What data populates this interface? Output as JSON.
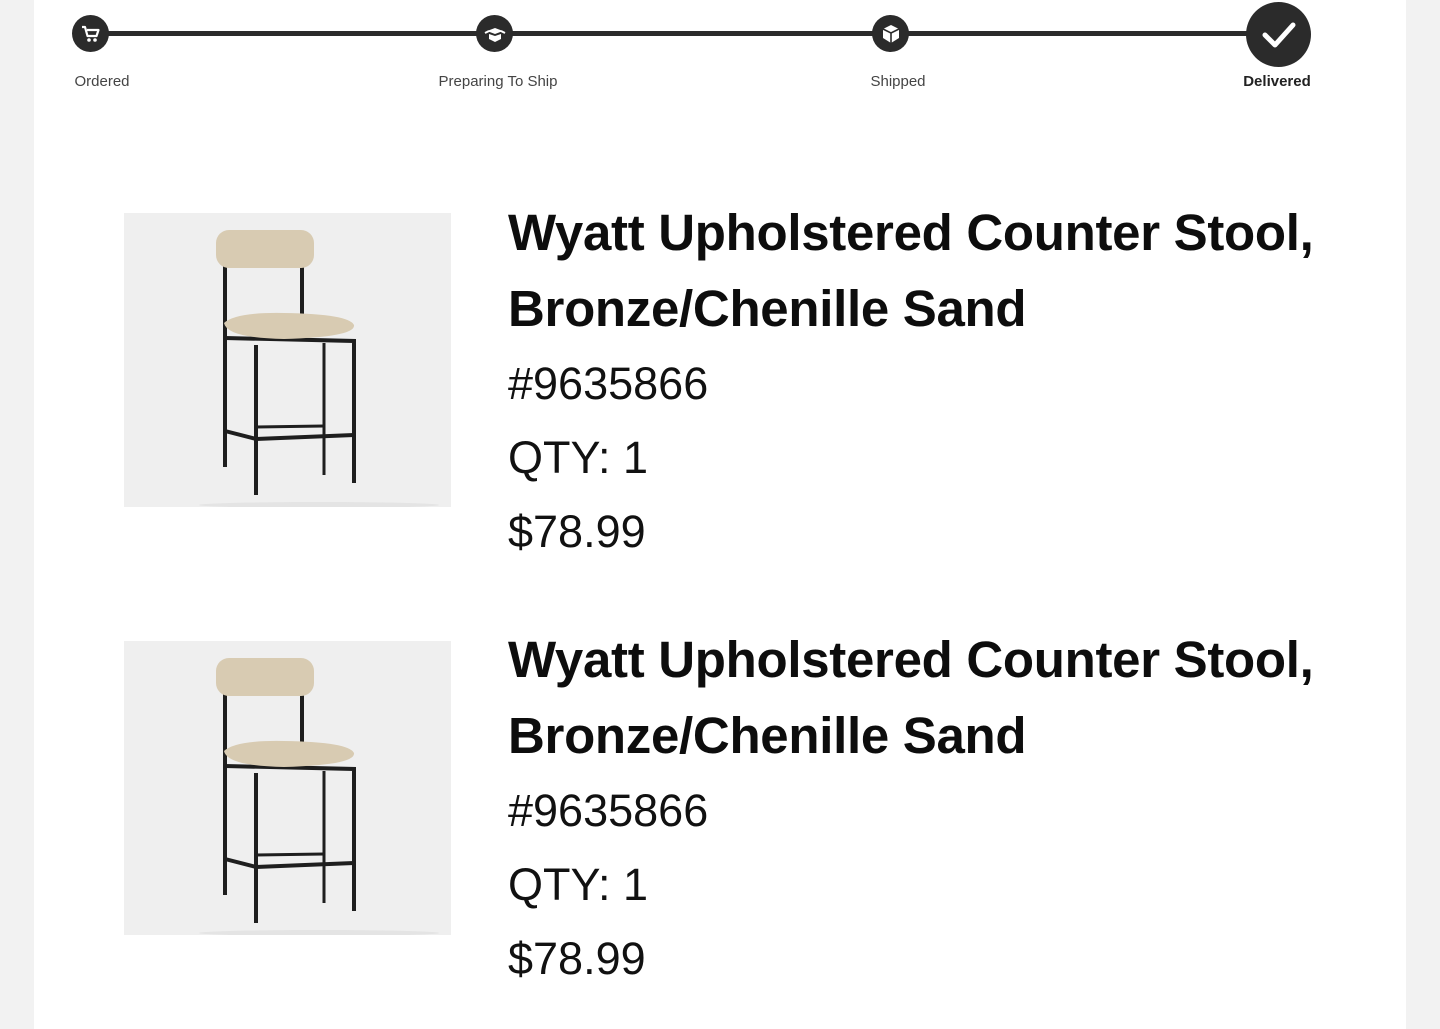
{
  "tracker": {
    "steps": [
      {
        "label": "Ordered",
        "icon": "cart-icon"
      },
      {
        "label": "Preparing To Ship",
        "icon": "box-open-icon"
      },
      {
        "label": "Shipped",
        "icon": "package-icon"
      },
      {
        "label": "Delivered",
        "icon": "checkmark-icon"
      }
    ],
    "current": "Delivered"
  },
  "items": [
    {
      "title_line1": "Wyatt Upholstered Counter Stool,",
      "title_line2": "Bronze/Chenille Sand",
      "sku": "#9635866",
      "qty": "QTY: 1",
      "price": "$78.99",
      "image": "counter-stool-image"
    },
    {
      "title_line1": "Wyatt Upholstered Counter Stool,",
      "title_line2": "Bronze/Chenille Sand",
      "sku": "#9635866",
      "qty": "QTY: 1",
      "price": "$78.99",
      "image": "counter-stool-image"
    }
  ],
  "colors": {
    "background": "#f2f2f2",
    "card": "#ffffff",
    "tracker": "#2b2b2b",
    "cushion": "#d8cbb2"
  }
}
